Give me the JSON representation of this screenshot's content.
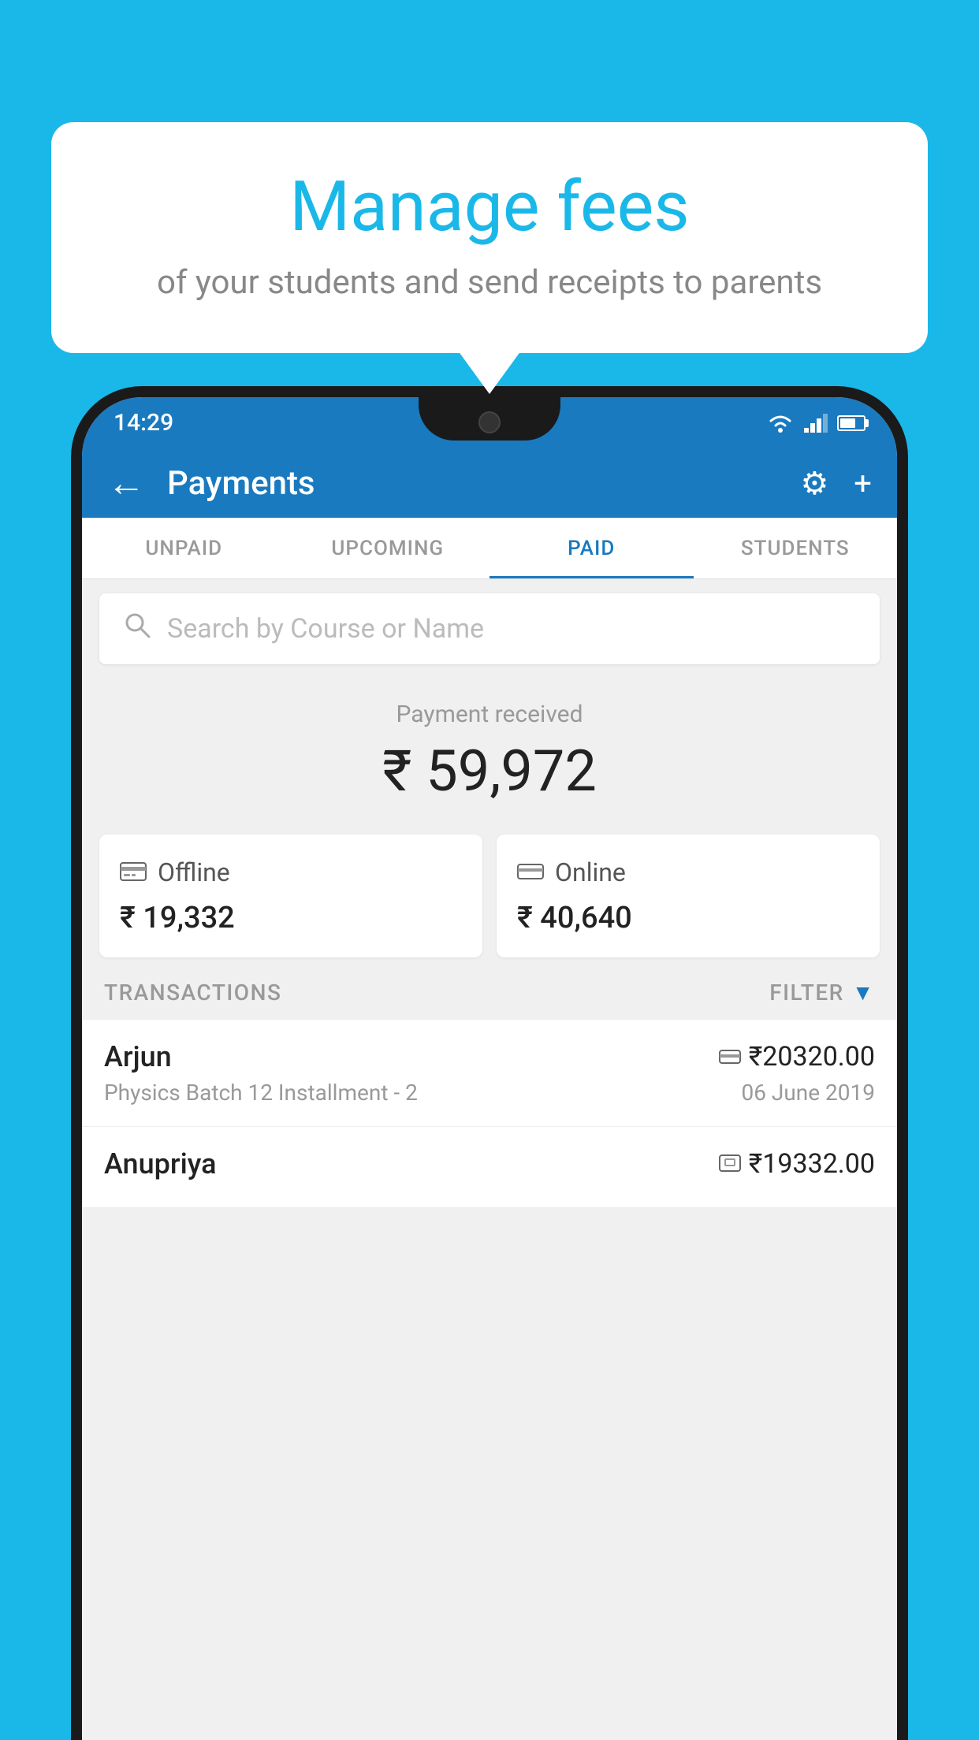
{
  "background_color": "#1ab8e8",
  "bubble": {
    "title": "Manage fees",
    "subtitle": "of your students and send receipts to parents"
  },
  "status_bar": {
    "time": "14:29"
  },
  "header": {
    "title": "Payments",
    "back_label": "←",
    "settings_label": "⚙",
    "add_label": "+"
  },
  "tabs": [
    {
      "label": "UNPAID",
      "active": false
    },
    {
      "label": "UPCOMING",
      "active": false
    },
    {
      "label": "PAID",
      "active": true
    },
    {
      "label": "STUDENTS",
      "active": false
    }
  ],
  "search": {
    "placeholder": "Search by Course or Name"
  },
  "payment_received": {
    "label": "Payment received",
    "amount": "₹ 59,972"
  },
  "payment_cards": [
    {
      "type": "Offline",
      "amount": "₹ 19,332",
      "icon": "🪙"
    },
    {
      "type": "Online",
      "amount": "₹ 40,640",
      "icon": "💳"
    }
  ],
  "transactions_header": {
    "label": "TRANSACTIONS",
    "filter_label": "FILTER"
  },
  "transactions": [
    {
      "name": "Arjun",
      "description": "Physics Batch 12 Installment - 2",
      "amount": "₹20320.00",
      "date": "06 June 2019",
      "type_icon": "💳"
    },
    {
      "name": "Anupriya",
      "description": "",
      "amount": "₹19332.00",
      "date": "",
      "type_icon": "🪙"
    }
  ]
}
